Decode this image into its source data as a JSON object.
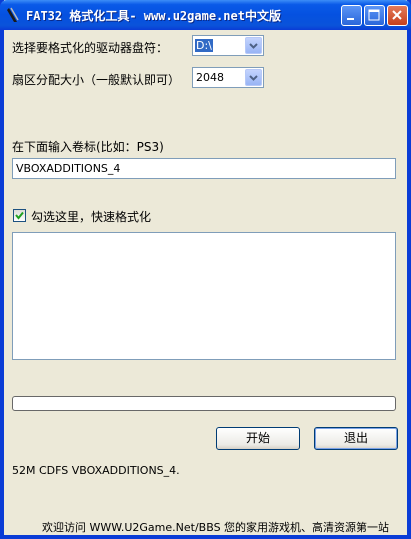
{
  "window": {
    "title": "FAT32 格式化工具- www.u2game.net中文版",
    "icon": "app-icon"
  },
  "drive": {
    "label": "选择要格式化的驱动器盘符：",
    "value": "D:\\"
  },
  "cluster": {
    "label": "扇区分配大小（一般默认即可）",
    "value": "2048"
  },
  "volume": {
    "label": "在下面输入卷标(比如：PS3)",
    "value": "VBOXADDITIONS_4"
  },
  "quick_format": {
    "label": "勾选这里，快速格式化",
    "checked": true
  },
  "log": {
    "content": ""
  },
  "progress": {
    "value": 0
  },
  "buttons": {
    "start": "开始",
    "exit": "退出"
  },
  "status": {
    "text": "52M CDFS VBOXADDITIONS_4."
  },
  "footer": {
    "text": "欢迎访问 WWW.U2Game.Net/BBS 您的家用游戏机、高清资源第一站"
  },
  "colors": {
    "titlebar": "#0A53DA",
    "window_bg": "#ECE9D8",
    "close_button": "#C7401C",
    "selection": "#316AC5"
  }
}
